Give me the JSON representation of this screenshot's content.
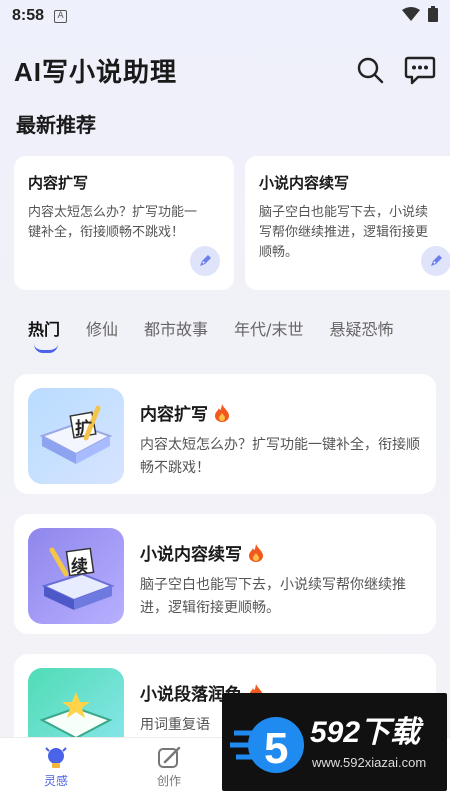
{
  "status_bar": {
    "time": "8:58",
    "notification_letter": "A"
  },
  "header": {
    "title": "AI写小说助理"
  },
  "recommend": {
    "section_title": "最新推荐",
    "cards": [
      {
        "title": "内容扩写",
        "desc": "内容太短怎么办？扩写功能一键补全，衔接顺畅不跳戏！"
      },
      {
        "title": "小说内容续写",
        "desc": "脑子空白也能写下去，小说续写帮你继续推进，逻辑衔接更顺畅。"
      }
    ]
  },
  "tabs": [
    "热门",
    "修仙",
    "都市故事",
    "年代/末世",
    "悬疑恐怖"
  ],
  "features": [
    {
      "title": "内容扩写",
      "desc": "内容太短怎么办？扩写功能一键补全，衔接顺畅不跳戏！",
      "thumb_char": "扩"
    },
    {
      "title": "小说内容续写",
      "desc": "脑子空白也能写下去，小说续写帮你继续推进，逻辑衔接更顺畅。",
      "thumb_char": "续"
    },
    {
      "title": "小说段落润色",
      "desc": "用词重复语",
      "thumb_char": ""
    }
  ],
  "bottom_nav": [
    {
      "label": "灵感",
      "icon": "lightbulb-icon"
    },
    {
      "label": "创作",
      "icon": "edit-icon"
    }
  ],
  "watermark": {
    "digit": "5",
    "brand": "592下载",
    "url": "www.592xiazai.com"
  },
  "colors": {
    "accent": "#4a63e8",
    "fire": "#f05a1e"
  }
}
